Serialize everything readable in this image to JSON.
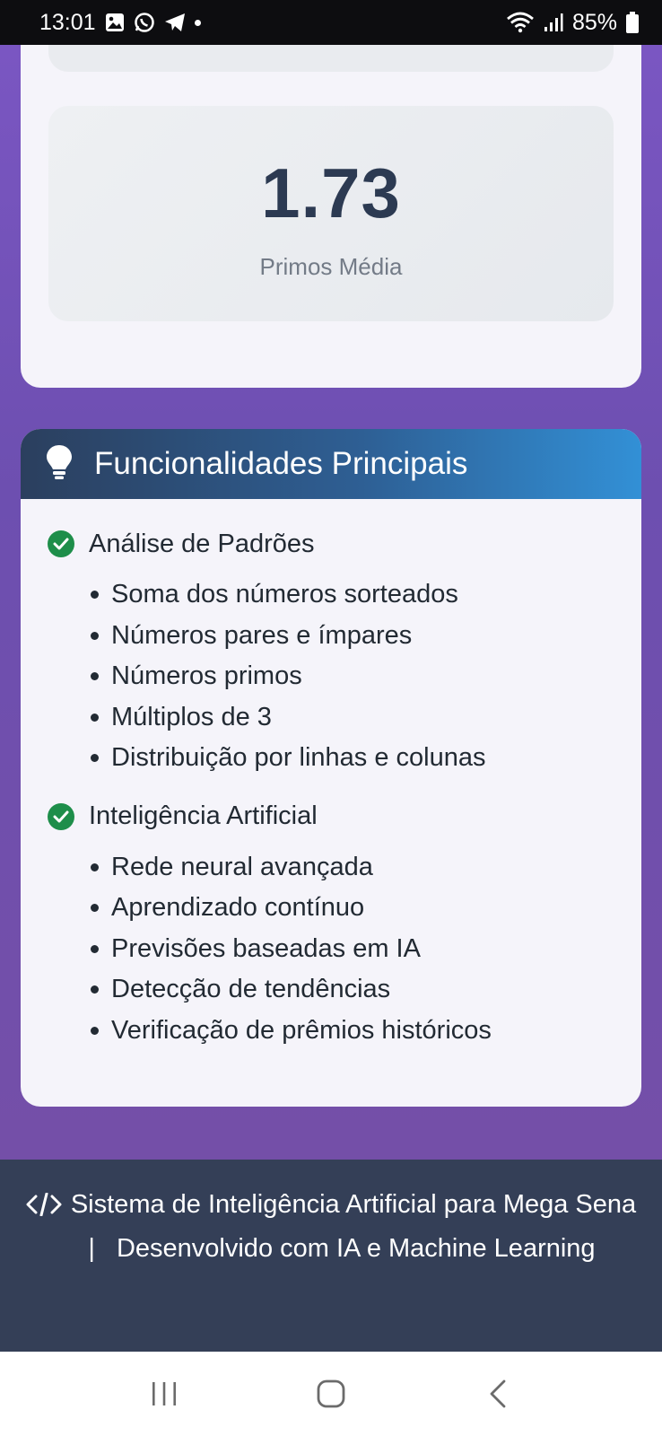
{
  "status_bar": {
    "time": "13:01",
    "battery": "85%",
    "icons": [
      "gallery-icon",
      "whatsapp-icon",
      "telegram-icon",
      "dot-icon",
      "wifi-icon",
      "signal-icon",
      "battery-icon"
    ]
  },
  "stats": {
    "value": "1.73",
    "label": "Primos Média"
  },
  "features": {
    "title": "Funcionalidades Principais",
    "icon": "lightbulb-icon",
    "sections": [
      {
        "title": "Análise de Padrões",
        "items": [
          "Soma dos números sorteados",
          "Números pares e ímpares",
          "Números primos",
          "Múltiplos de 3",
          "Distribuição por linhas e colunas"
        ]
      },
      {
        "title": "Inteligência Artificial",
        "items": [
          "Rede neural avançada",
          "Aprendizado contínuo",
          "Previsões baseadas em IA",
          "Detecção de tendências",
          "Verificação de prêmios históricos"
        ]
      }
    ]
  },
  "footer": {
    "text_part1": "Sistema de Inteligência Artificial para Mega Sena",
    "separator": "|",
    "text_part2": "Desenvolvido com IA e Machine Learning",
    "icon": "code-icon"
  },
  "colors": {
    "background_purple": "#7453b8",
    "card": "#f5f4fa",
    "header_start": "#2b3f5e",
    "header_end": "#3290d6",
    "check": "#1e8e4a",
    "footer": "#343f57"
  }
}
